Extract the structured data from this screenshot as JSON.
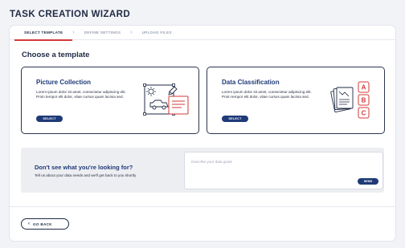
{
  "page": {
    "title": "TASK CREATION WIZARD"
  },
  "steps": [
    {
      "label": "SELECT TEMPLATE",
      "active": true
    },
    {
      "label": "DEFINE SETTINGS",
      "active": false
    },
    {
      "label": "UPLOAD FILES",
      "active": false
    }
  ],
  "section": {
    "title": "Choose a template"
  },
  "templates": [
    {
      "title": "Picture Collection",
      "description": "Lorem ipsum dolor sit amet, consectetur adipiscing elit. Proin tempor elit dolor, vitae cursus quam lacinia sed.",
      "button": "SELECT",
      "icon": "picture-collection-icon"
    },
    {
      "title": "Data Classification",
      "description": "Lorem ipsum dolor sit amet, consectetur adipiscing elit. Proin tempor elit dolor, vitae cursus quam lacinia sed.",
      "button": "SELECT",
      "icon": "data-classification-icon",
      "labels": [
        "A",
        "B",
        "C"
      ]
    }
  ],
  "help": {
    "title": "Don't see what you're looking for?",
    "subtitle": "Tell us about your data needs and we'll get back to you shortly",
    "placeholder": "Describe your data goals",
    "send": "SEND"
  },
  "footer": {
    "back": "GO BACK"
  },
  "colors": {
    "primary": "#1f3a78",
    "accent": "#d33a3a",
    "text": "#1f2a44",
    "background": "#f2f3f7"
  }
}
